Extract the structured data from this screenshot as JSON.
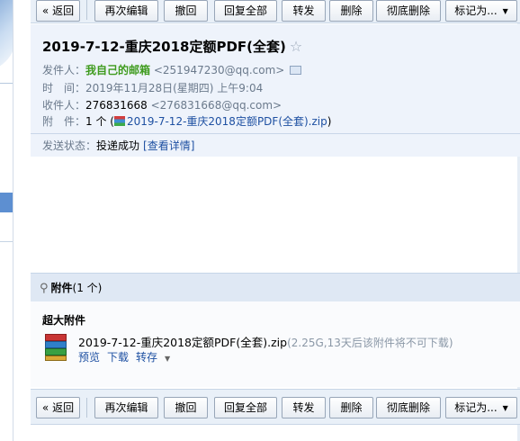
{
  "toolbar": {
    "back": "« 返回",
    "reedit": "再次编辑",
    "recall": "撤回",
    "reply_all": "回复全部",
    "forward": "转发",
    "delete": "删除",
    "purge": "彻底删除",
    "mark_as": "标记为..."
  },
  "mail": {
    "subject": "2019-7-12-重庆2018定额PDF(全套)",
    "sender_label": "发件人：",
    "sender_name": "我自己的邮箱",
    "sender_email": "<251947230@qq.com>",
    "time_label": "时　间：",
    "time_value": "2019年11月28日(星期四) 上午9:04",
    "recipient_label": "收件人：",
    "recipient_name": "276831668",
    "recipient_email": "<276831668@qq.com>",
    "attach_label": "附　件：",
    "attach_count": "1 个 (",
    "attach_file": "2019-7-12-重庆2018定额PDF(全套).zip",
    "attach_close": ")",
    "status_label": "发送状态：",
    "status_value": "投递成功",
    "status_detail": "[查看详情]"
  },
  "attachments": {
    "header_title": "附件",
    "header_count": "(1 个)",
    "big_title": "超大附件",
    "file_name": "2019-7-12-重庆2018定额PDF(全套).zip",
    "file_meta": "(2.25G,13天后该附件将不可下载)",
    "preview": "预览",
    "download": "下载",
    "save_to": "转存"
  },
  "colors": {
    "toolbar_bg": "#e9f0f8",
    "header_bg": "#eef3fb",
    "link": "#1e50a2",
    "sender_green": "#3f9b1e"
  }
}
